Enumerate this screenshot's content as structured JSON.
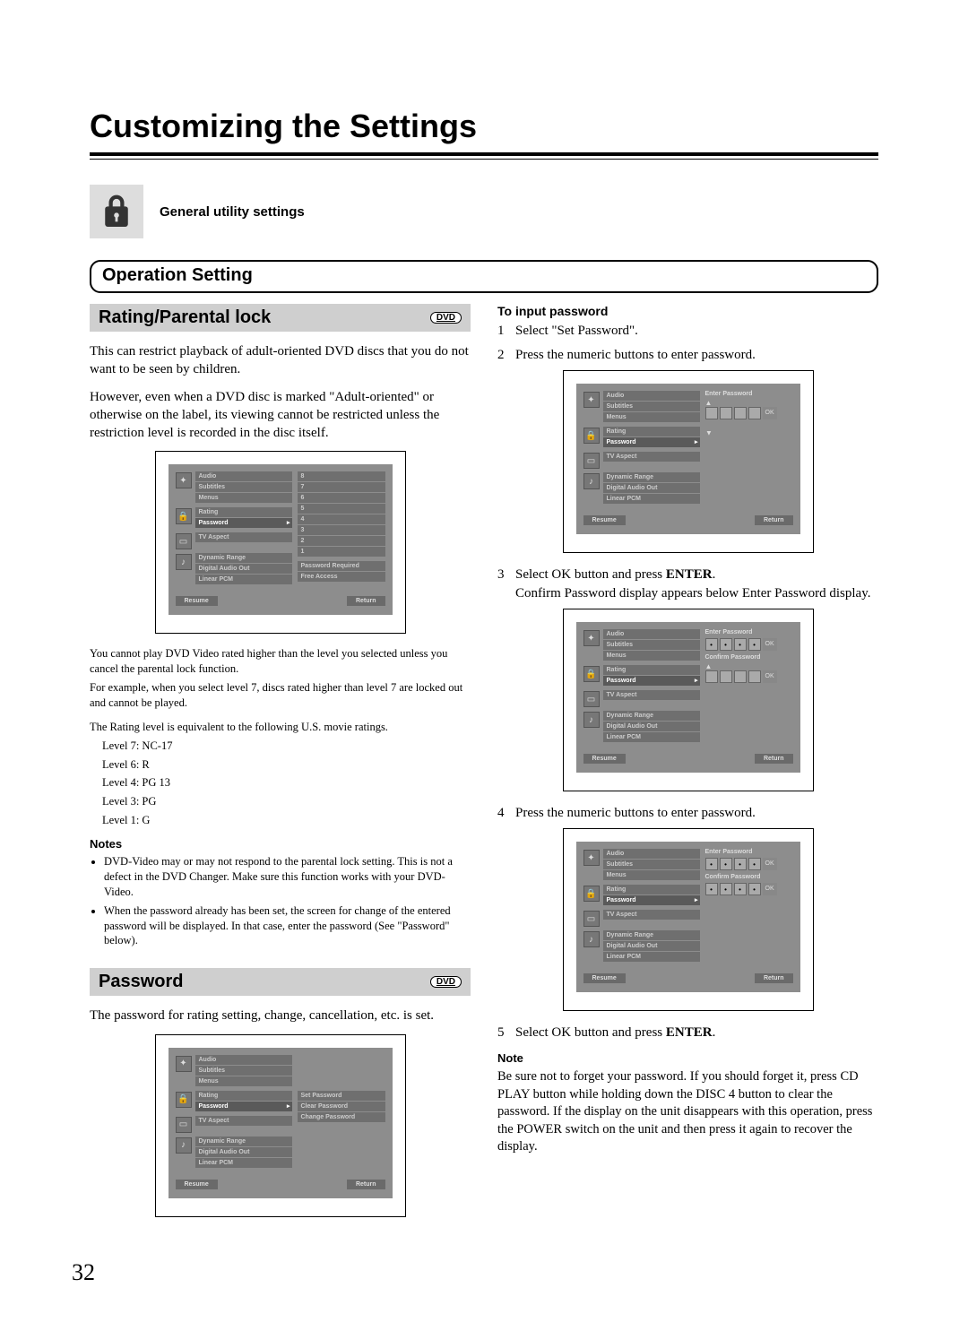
{
  "page": {
    "title": "Customizing the Settings",
    "subtitle": "General utility settings",
    "section": "Operation Setting",
    "number": "32"
  },
  "badges": {
    "dvd": "DVD"
  },
  "left": {
    "rating_title": "Rating/Parental lock",
    "p1": "This can restrict playback of adult-oriented DVD discs that you do not want to be seen by children.",
    "p2": "However, even when a DVD disc is marked \"Adult-oriented\" or otherwise on the label, its viewing cannot be restricted unless the restriction level is recorded in the disc itself.",
    "p3": "You cannot play DVD Video rated higher than the level you selected unless you cancel the parental lock function.",
    "p4": "For example, when you select level 7, discs rated higher than level 7 are locked out and cannot be played.",
    "p5": "The Rating level is equivalent to the following U.S. movie ratings.",
    "levels": {
      "l7": "Level 7:  NC-17",
      "l6": "Level 6:  R",
      "l4": "Level 4:  PG 13",
      "l3": "Level 3:  PG",
      "l1": "Level 1:  G"
    },
    "notes_h": "Notes",
    "notes": [
      "DVD-Video may or may not respond to the parental lock setting. This is not a defect in the DVD Changer. Make sure this function works with your DVD-Video.",
      "When the password already has been set, the screen for change of the entered password will be displayed. In that case, enter the password (See \"Password\" below)."
    ],
    "pw_title": "Password",
    "pw_p1": "The password for rating setting, change, cancellation, etc. is set."
  },
  "right": {
    "h1": "To input password",
    "s1": "Select \"Set Password\".",
    "s2": "Press the numeric buttons to enter password.",
    "s3a": "Select OK button and press ",
    "s3b": "ENTER",
    "s3c": ".",
    "s3d": "Confirm Password display appears below Enter Password display.",
    "s4": "Press the numeric buttons to enter password.",
    "s5a": "Select OK button and press ",
    "s5b": "ENTER",
    "s5c": ".",
    "note_h": "Note",
    "note": "Be sure not to forget your password. If you should forget it, press CD PLAY button while holding down the DISC 4 button to clear the password. If the display on the unit disappears with this operation, press the POWER switch on the unit and then press it again to recover the display."
  },
  "osd": {
    "menu": {
      "g1": [
        "Audio",
        "Subtitles",
        "Menus"
      ],
      "g2": [
        "Rating",
        "Password"
      ],
      "g3": [
        "TV Aspect"
      ],
      "g4": [
        "Dynamic Range",
        "Digital Audio Out",
        "Linear PCM"
      ]
    },
    "footer": {
      "resume": "Resume",
      "return": "Return"
    },
    "rating_levels": [
      "8",
      "7",
      "6",
      "5",
      "4",
      "3",
      "2",
      "1"
    ],
    "rating_extra": [
      "Password Required",
      "Free Access"
    ],
    "pw_opts": [
      "Set Password",
      "Clear Password",
      "Change Password"
    ],
    "enter_pw": "Enter Password",
    "confirm_pw": "Confirm Password",
    "ok": "OK"
  }
}
